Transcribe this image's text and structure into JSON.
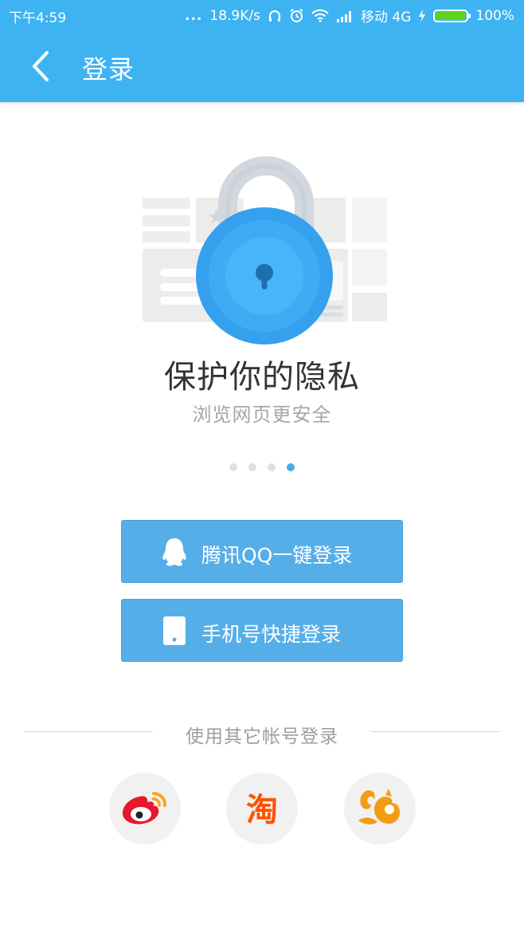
{
  "status_bar": {
    "time": "下午4:59",
    "dots": "...",
    "speed": "18.9K/s",
    "carrier": "移动 4G",
    "battery": "100%",
    "icons": [
      "headphones-icon",
      "alarm-icon",
      "wifi-icon",
      "signal-icon",
      "charging-icon",
      "battery-icon"
    ]
  },
  "header": {
    "title": "登录",
    "back_icon": "chevron-left-icon",
    "background": "#3eb3f2"
  },
  "hero": {
    "icon": "padlock-privacy-icon",
    "title": "保护你的隐私",
    "subtitle": "浏览网页更安全"
  },
  "pager": {
    "count": 4,
    "active_index": 3
  },
  "buttons": {
    "qq_login": {
      "label": "腾讯QQ一键登录",
      "icon": "qq-penguin-icon"
    },
    "phone_login": {
      "label": "手机号快捷登录",
      "icon": "phone-icon"
    },
    "color": "#56aee8"
  },
  "other_login": {
    "label": "使用其它帐号登录",
    "providers": [
      {
        "name": "weibo",
        "icon": "weibo-icon",
        "color": "#e6162d"
      },
      {
        "name": "taobao",
        "icon": "taobao-icon",
        "glyph": "淘",
        "color": "#ff5000"
      },
      {
        "name": "uc",
        "icon": "uc-squirrel-icon",
        "color": "#f39c12"
      }
    ]
  }
}
